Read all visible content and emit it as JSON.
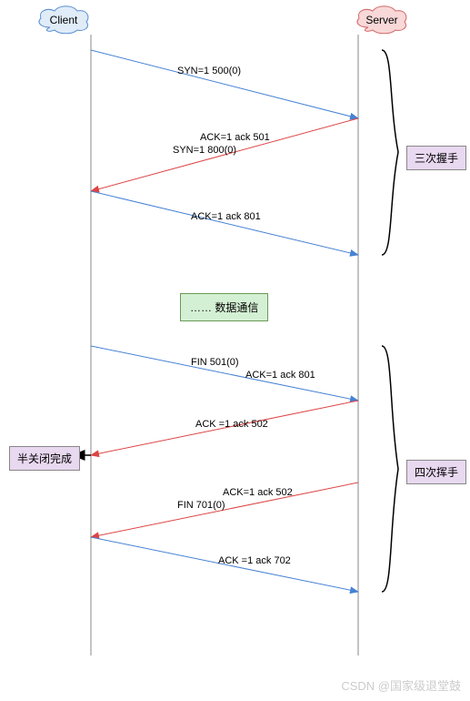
{
  "nodes": {
    "client": "Client",
    "server": "Server"
  },
  "messages": {
    "syn1": "SYN=1 500(0)",
    "ack1": "ACK=1 ack  501",
    "syn2": "SYN=1 800(0)",
    "ack2": "ACK=1 ack 801",
    "data": "……  数据通信",
    "fin1": "FIN 501(0)",
    "fin1_ack_label": "ACK=1 ack 801",
    "ack3": "ACK =1 ack 502",
    "ack4": "ACK=1 ack 502",
    "fin2": "FIN 701(0)",
    "ack5": "ACK =1 ack 702"
  },
  "labels": {
    "handshake": "三次握手",
    "wave": "四次挥手",
    "half_close": "半关闭完成"
  },
  "watermark": "CSDN @国家级退堂鼓"
}
